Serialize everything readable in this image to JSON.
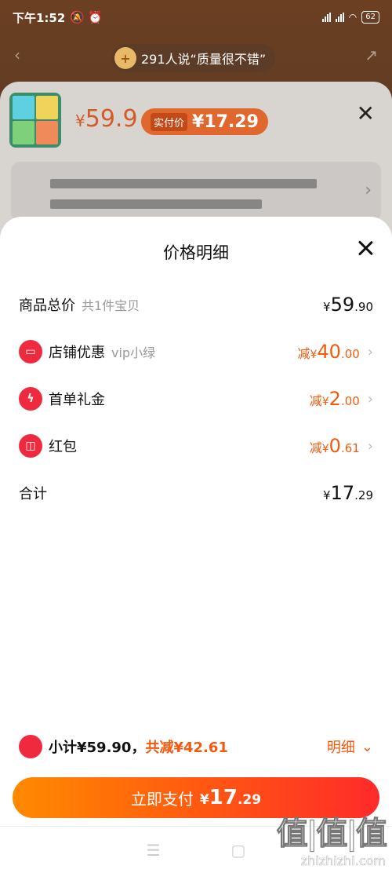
{
  "status_bar": {
    "time": "下午1:52",
    "battery": "62"
  },
  "background_page": {
    "quality_text": "291人说“质量很不错”"
  },
  "product_sheet": {
    "price_currency": "¥",
    "price": "59.9",
    "real_price_label": "实付价",
    "real_price": "¥17.29"
  },
  "price_detail": {
    "title": "价格明细",
    "rows": [
      {
        "label": "商品总价",
        "sub": "共1件宝贝",
        "prefix": "",
        "yen": "¥",
        "int": "59",
        "dec": ".90",
        "style": "black"
      },
      {
        "label": "店铺优惠",
        "sub": "vip小绿",
        "prefix": "减",
        "yen": "¥",
        "int": "40",
        "dec": ".00",
        "style": "orange",
        "icon": "store-coupon-icon"
      },
      {
        "label": "首单礼金",
        "sub": "",
        "prefix": "减",
        "yen": "¥",
        "int": "2",
        "dec": ".00",
        "style": "orange",
        "icon": "lightning-icon"
      },
      {
        "label": "红包",
        "sub": "",
        "prefix": "减",
        "yen": "¥",
        "int": "0",
        "dec": ".61",
        "style": "orange",
        "icon": "red-packet-icon"
      },
      {
        "label": "合计",
        "sub": "",
        "prefix": "",
        "yen": "¥",
        "int": "17",
        "dec": ".29",
        "style": "black"
      }
    ],
    "subtotal_text": "小计¥59.90，",
    "subtotal_save": "共减¥42.61",
    "detail_link": "明细",
    "pay_label": "立即支付",
    "pay_yen": "¥",
    "pay_int": "17",
    "pay_dec": ".29"
  },
  "watermark": {
    "mark": "值|值|值",
    "url": "zhizhizhi.com"
  },
  "colors": {
    "accent": "#f25a10",
    "icon_red": "#ef2a3f"
  }
}
